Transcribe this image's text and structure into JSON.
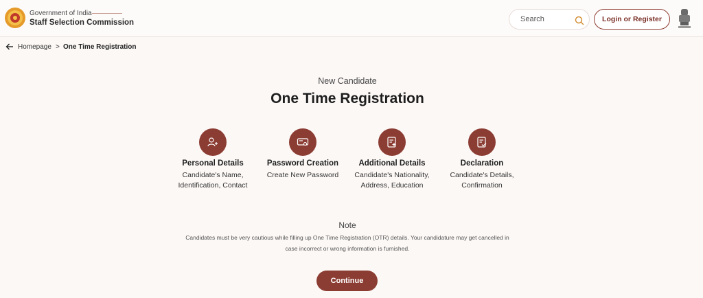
{
  "header": {
    "brand_line1": "Government of India",
    "brand_line2": "Staff Selection Commission",
    "search_placeholder": "Search",
    "login_label": "Login or Register",
    "accent_color": "#8c3d33"
  },
  "breadcrumb": {
    "home": "Homepage",
    "separator": ">",
    "current": "One Time Registration"
  },
  "main": {
    "subtitle": "New Candidate",
    "title": "One Time Registration",
    "steps": [
      {
        "icon": "user-plus-icon",
        "title": "Personal Details",
        "description": "Candidate's Name, Identification, Contact"
      },
      {
        "icon": "password-icon",
        "title": "Password Creation",
        "description": "Create New Password"
      },
      {
        "icon": "document-add-icon",
        "title": "Additional Details",
        "description": "Candidate's Nationality, Address, Education"
      },
      {
        "icon": "document-check-icon",
        "title": "Declaration",
        "description": "Candidate's Details, Confirmation"
      }
    ],
    "note_title": "Note",
    "note_text": "Candidates must be very cautious while filling up One Time Registration (OTR) details. Your candidature may get cancelled in case incorrect or wrong information is furnished.",
    "continue_label": "Continue"
  }
}
